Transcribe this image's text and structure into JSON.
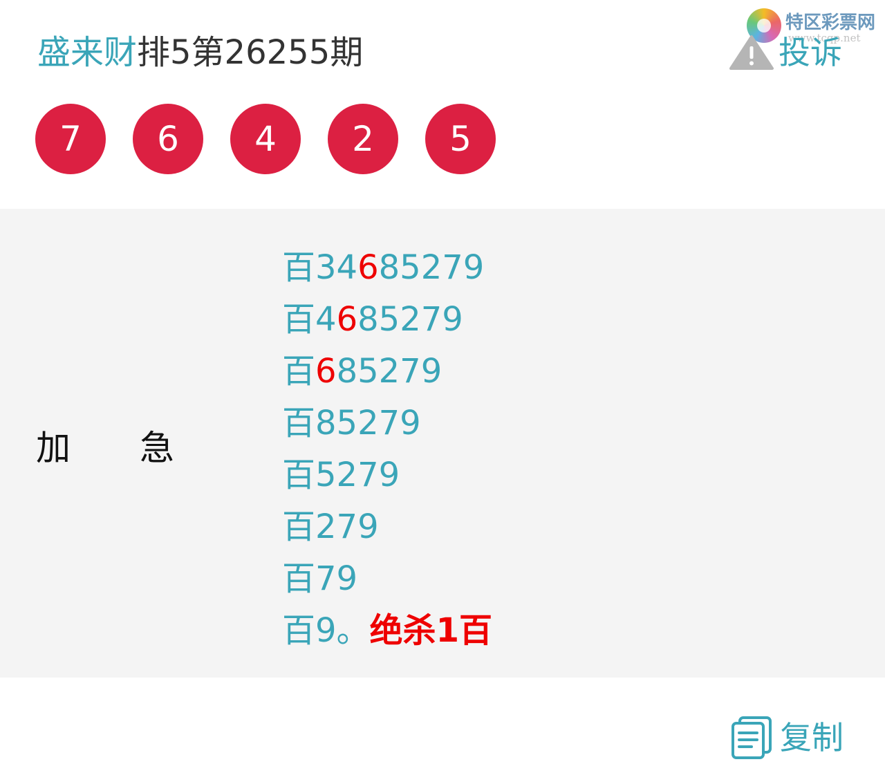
{
  "header": {
    "author": "盛来财",
    "issue_title": "排5第26255期",
    "complain_label": "投诉"
  },
  "logo": {
    "brand": "特区彩票网",
    "url": "www.tcqp.net"
  },
  "draw_numbers": [
    "7",
    "6",
    "4",
    "2",
    "5"
  ],
  "panel": {
    "label_chars": [
      "加",
      "急"
    ],
    "lines": [
      {
        "prefix": "百",
        "before": "34",
        "highlight": "6",
        "after": "85279"
      },
      {
        "prefix": "百",
        "before": "4",
        "highlight": "6",
        "after": "85279"
      },
      {
        "prefix": "百",
        "before": "",
        "highlight": "6",
        "after": "85279"
      },
      {
        "prefix": "百",
        "before": "85279",
        "highlight": "",
        "after": ""
      },
      {
        "prefix": "百",
        "before": "5279",
        "highlight": "",
        "after": ""
      },
      {
        "prefix": "百",
        "before": "279",
        "highlight": "",
        "after": ""
      },
      {
        "prefix": "百",
        "before": "79",
        "highlight": "",
        "after": ""
      },
      {
        "prefix": "百",
        "before": "9。",
        "highlight": "",
        "after": "",
        "kill": "绝杀1百"
      }
    ]
  },
  "footer": {
    "copy_label": "复制"
  },
  "colors": {
    "accent": "#3aa5b8",
    "ball": "#dc2042",
    "highlight": "#ee0000",
    "panel_bg": "#f4f4f4"
  }
}
